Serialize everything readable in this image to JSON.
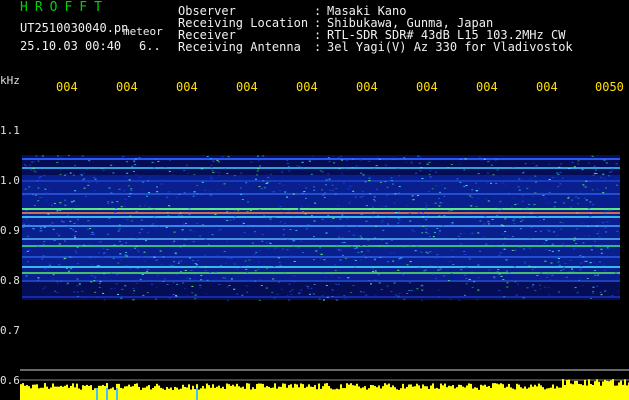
{
  "header": {
    "app_title": "HROFFT",
    "filename": "UT2510030040.pn",
    "mode": "meteor",
    "datetime": "25.10.03 00:40",
    "count": "6.."
  },
  "station_info": [
    {
      "label": "Observer",
      "value": "Masaki Kano"
    },
    {
      "label": "Receiving Location",
      "value": "Shibukawa, Gunma, Japan"
    },
    {
      "label": "Receiver",
      "value": "RTL-SDR SDR# 43dB L15 103.2MHz CW"
    },
    {
      "label": "Receiving Antenna",
      "value": "3el Yagi(V) Az 330 for Vladivostok"
    }
  ],
  "info_separator": ":",
  "time_axis": {
    "labels": [
      "004",
      "004",
      "004",
      "004",
      "004",
      "004",
      "004",
      "004",
      "004",
      "0050"
    ]
  },
  "freq_axis": {
    "unit": "kHz",
    "labels": [
      "1.1",
      "1.0",
      "0.9",
      "0.8",
      "0.7",
      "0.6"
    ]
  },
  "colors": {
    "background": "#000000",
    "title_green": "#00d200",
    "axis_yellow": "#ffe000",
    "signal_yellow": "#ffff00",
    "noise_blue": "#1020c0"
  }
}
